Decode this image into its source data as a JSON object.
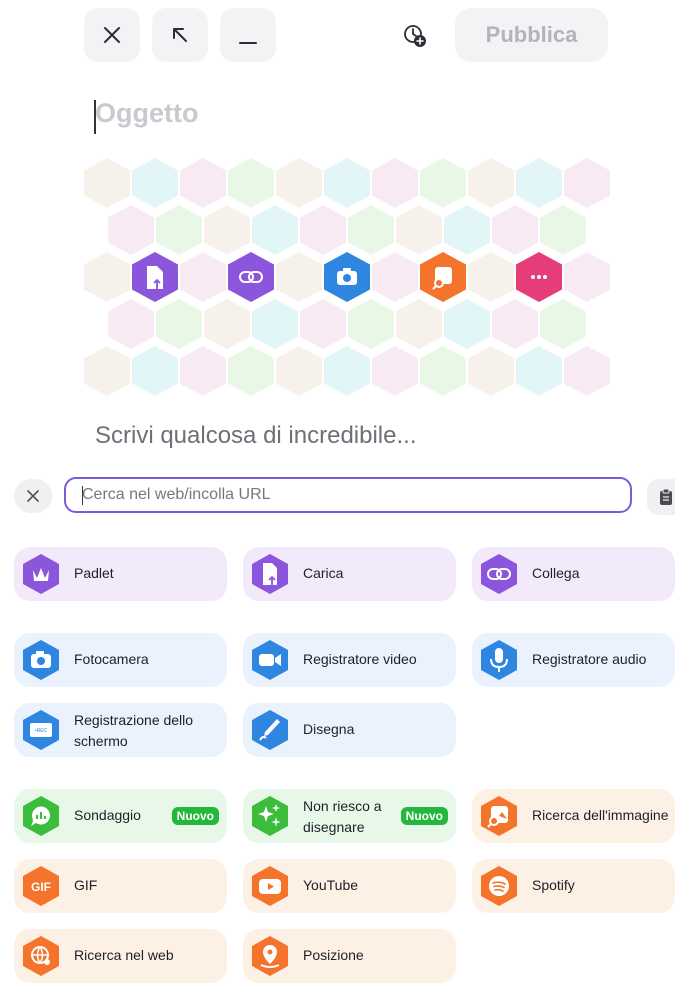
{
  "toolbar": {
    "publish_label": "Pubblica",
    "close_icon": "close-icon",
    "expand_icon": "arrow-up-left-icon",
    "minimize_icon": "minimize-icon",
    "schedule_icon": "clock-plus-icon"
  },
  "editor": {
    "subject_placeholder": "Oggetto",
    "body_placeholder": "Scrivi qualcosa di incredibile...",
    "quick_attachments": [
      "upload-icon",
      "link-icon",
      "camera-icon",
      "image-search-icon",
      "more-icon"
    ]
  },
  "search": {
    "placeholder": "Cerca nel web/incolla URL",
    "value": ""
  },
  "attachment_options": [
    {
      "label": "Padlet",
      "icon": "padlet-icon",
      "group": "purple"
    },
    {
      "label": "Carica",
      "icon": "upload-icon",
      "group": "purple"
    },
    {
      "label": "Collega",
      "icon": "link-icon",
      "group": "purple"
    },
    {
      "label": "Fotocamera",
      "icon": "camera-icon",
      "group": "blue"
    },
    {
      "label": "Registratore video",
      "icon": "video-icon",
      "group": "blue"
    },
    {
      "label": "Registratore audio",
      "icon": "microphone-icon",
      "group": "blue"
    },
    {
      "label": "Registrazione dello schermo",
      "icon": "screen-record-icon",
      "group": "blue"
    },
    {
      "label": "Disegna",
      "icon": "draw-icon",
      "group": "blue"
    },
    {
      "label": "Sondaggio",
      "icon": "poll-icon",
      "group": "green",
      "badge": "Nuovo"
    },
    {
      "label": "Non riesco a disegnare",
      "icon": "sparkle-icon",
      "group": "green",
      "badge": "Nuovo"
    },
    {
      "label": "Ricerca dell'immagine",
      "icon": "image-search-icon",
      "group": "orange"
    },
    {
      "label": "GIF",
      "icon": "gif-icon",
      "group": "orange"
    },
    {
      "label": "YouTube",
      "icon": "youtube-icon",
      "group": "orange"
    },
    {
      "label": "Spotify",
      "icon": "spotify-icon",
      "group": "orange"
    },
    {
      "label": "Ricerca nel web",
      "icon": "web-search-icon",
      "group": "orange"
    },
    {
      "label": "Posizione",
      "icon": "location-icon",
      "group": "orange"
    }
  ],
  "colors": {
    "accent": "#7c5ad8",
    "purple_icon": "#8b55dc",
    "blue_icon": "#2f86e0",
    "green_icon": "#3bbd3b",
    "orange_icon": "#f5742b",
    "pink_icon": "#e63d7a",
    "badge_green": "#23b83c"
  }
}
